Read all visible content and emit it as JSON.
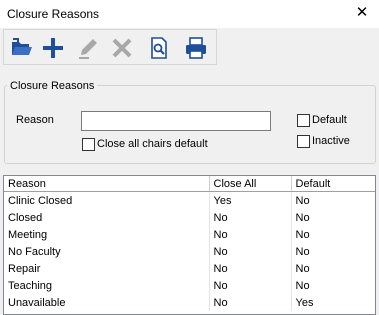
{
  "window": {
    "title": "Closure Reasons",
    "close_glyph": "✕"
  },
  "toolbar": {
    "buttons": [
      {
        "name": "open-icon",
        "enabled": true
      },
      {
        "name": "add-icon",
        "enabled": true
      },
      {
        "name": "edit-icon",
        "enabled": false
      },
      {
        "name": "delete-icon",
        "enabled": false
      },
      {
        "name": "preview-icon",
        "enabled": true
      },
      {
        "name": "print-icon",
        "enabled": true
      }
    ]
  },
  "form": {
    "group_label": "Closure Reasons",
    "reason_label": "Reason",
    "reason_value": "",
    "close_all_label": "Close all chairs default",
    "close_all_checked": false,
    "default_label": "Default",
    "default_checked": false,
    "inactive_label": "Inactive",
    "inactive_checked": false
  },
  "grid": {
    "columns": [
      "Reason",
      "Close All",
      "Default"
    ],
    "rows": [
      [
        "Clinic Closed",
        "Yes",
        "No"
      ],
      [
        "Closed",
        "No",
        "No"
      ],
      [
        "Meeting",
        "No",
        "No"
      ],
      [
        "No Faculty",
        "No",
        "No"
      ],
      [
        "Repair",
        "No",
        "No"
      ],
      [
        "Teaching",
        "No",
        "No"
      ],
      [
        "Unavailable",
        "No",
        "Yes"
      ]
    ]
  },
  "colors": {
    "accent_blue": "#1f4e9c",
    "disabled_gray": "#a8a8a8"
  }
}
